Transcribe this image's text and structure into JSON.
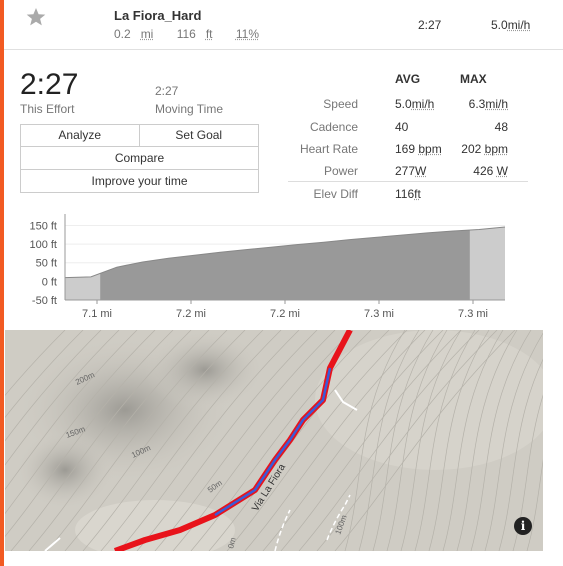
{
  "segment": {
    "name": "La Fiora_Hard",
    "distance": "0.2",
    "distance_unit": "mi",
    "elev": "116",
    "elev_unit": "ft",
    "grade": "11%",
    "time": "2:27",
    "speed": "5.0",
    "speed_unit": "mi/h"
  },
  "effort": {
    "time": "2:27",
    "time_label": "This Effort",
    "moving_time": "2:27",
    "moving_label": "Moving Time"
  },
  "buttons": {
    "analyze": "Analyze",
    "set_goal": "Set Goal",
    "compare": "Compare",
    "improve": "Improve your time"
  },
  "stats": {
    "avg_header": "AVG",
    "max_header": "MAX",
    "rows": [
      {
        "label": "Speed",
        "avg": "5.0",
        "avg_unit": "mi/h",
        "max": "6.3",
        "max_unit": "mi/h"
      },
      {
        "label": "Cadence",
        "avg": "40",
        "avg_unit": "",
        "max": "48",
        "max_unit": ""
      },
      {
        "label": "Heart Rate",
        "avg": "169",
        "avg_unit": "bpm",
        "max": "202",
        "max_unit": "bpm"
      },
      {
        "label": "Power",
        "avg": "277",
        "avg_unit": "W",
        "max": "426",
        "max_unit": "W"
      },
      {
        "label": "Elev Diff",
        "avg": "116",
        "avg_unit": "ft",
        "max": "",
        "max_unit": ""
      }
    ]
  },
  "chart_data": {
    "type": "area",
    "y_ticks": [
      "150 ft",
      "100 ft",
      "50 ft",
      "0 ft",
      "-50 ft"
    ],
    "y_tick_values": [
      150,
      100,
      50,
      0,
      -50
    ],
    "x_ticks": [
      "7.1 mi",
      "7.2 mi",
      "7.2 mi",
      "7.3 mi",
      "7.3 mi"
    ],
    "ylim": [
      -50,
      170
    ],
    "profile": [
      10,
      12,
      38,
      52,
      62,
      70,
      78,
      85,
      92,
      99,
      105,
      112,
      118,
      124,
      130,
      135,
      139,
      146
    ],
    "highlight_range": [
      0.08,
      0.92
    ],
    "colors": {
      "highlight": "#999999",
      "context": "#cccccc",
      "line": "#888888"
    }
  },
  "map": {
    "road_name": "Via La Fiora",
    "contour_labels": [
      "200m",
      "150m",
      "100m",
      "50m",
      "100m",
      "0m"
    ],
    "info_glyph": "i",
    "colors": {
      "route": "#e8131b",
      "effort": "#3b5bd6",
      "terrain": "#cfccc4"
    }
  }
}
